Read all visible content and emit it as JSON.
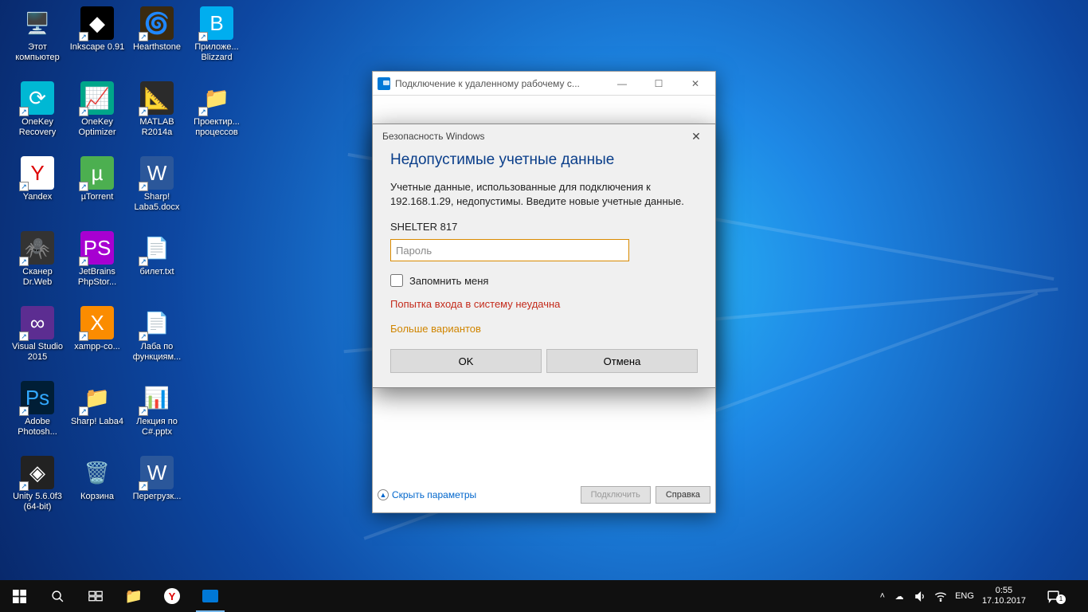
{
  "desktop_icons": [
    {
      "label": "Этот компьютер",
      "col": 0,
      "row": 0,
      "glyph": "🖥️",
      "bg": ""
    },
    {
      "label": "Inkscape 0.91",
      "col": 1,
      "row": 0,
      "glyph": "◆",
      "bg": "#000"
    },
    {
      "label": "Hearthstone",
      "col": 2,
      "row": 0,
      "glyph": "🌀",
      "bg": "#3a2a10"
    },
    {
      "label": "Приложе... Blizzard",
      "col": 3,
      "row": 0,
      "glyph": "B",
      "bg": "#00aeef"
    },
    {
      "label": "OneKey Recovery",
      "col": 0,
      "row": 1,
      "glyph": "⟳",
      "bg": "#00b8d4"
    },
    {
      "label": "OneKey Optimizer",
      "col": 1,
      "row": 1,
      "glyph": "📈",
      "bg": "#00a68a"
    },
    {
      "label": "MATLAB R2014a",
      "col": 2,
      "row": 1,
      "glyph": "📐",
      "bg": "#2b2b2b"
    },
    {
      "label": "Проектир... процессов",
      "col": 3,
      "row": 1,
      "glyph": "📁",
      "bg": ""
    },
    {
      "label": "Yandex",
      "col": 0,
      "row": 2,
      "glyph": "Y",
      "bg": "#fff",
      "fg": "#d00"
    },
    {
      "label": "µTorrent",
      "col": 1,
      "row": 2,
      "glyph": "µ",
      "bg": "#4caf50"
    },
    {
      "label": "Sharp! Laba5.docx",
      "col": 2,
      "row": 2,
      "glyph": "W",
      "bg": "#2b579a"
    },
    {
      "label": "Сканер Dr.Web",
      "col": 0,
      "row": 3,
      "glyph": "🕷️",
      "bg": "#333"
    },
    {
      "label": "JetBrains PhpStor...",
      "col": 1,
      "row": 3,
      "glyph": "PS",
      "bg": "#a700d1"
    },
    {
      "label": "билет.txt",
      "col": 2,
      "row": 3,
      "glyph": "📄",
      "bg": ""
    },
    {
      "label": "Visual Studio 2015",
      "col": 0,
      "row": 4,
      "glyph": "∞",
      "bg": "#5c2d91"
    },
    {
      "label": "xampp-co...",
      "col": 1,
      "row": 4,
      "glyph": "X",
      "bg": "#fb8c00"
    },
    {
      "label": "Лаба по функциям...",
      "col": 2,
      "row": 4,
      "glyph": "📄",
      "bg": ""
    },
    {
      "label": "Adobe Photosh...",
      "col": 0,
      "row": 5,
      "glyph": "Ps",
      "bg": "#001e36",
      "fg": "#31a8ff"
    },
    {
      "label": "Sharp! Laba4",
      "col": 1,
      "row": 5,
      "glyph": "📁",
      "bg": ""
    },
    {
      "label": "Лекция по C#.pptx",
      "col": 2,
      "row": 5,
      "glyph": "📊",
      "bg": ""
    },
    {
      "label": "Unity 5.6.0f3 (64-bit)",
      "col": 0,
      "row": 6,
      "glyph": "◈",
      "bg": "#222"
    },
    {
      "label": "Корзина",
      "col": 1,
      "row": 6,
      "glyph": "🗑️",
      "bg": ""
    },
    {
      "label": "Перегрузк...",
      "col": 2,
      "row": 6,
      "glyph": "W",
      "bg": "#2b579a"
    }
  ],
  "rdp_window": {
    "title": "Подключение к удаленному рабочему с...",
    "hide_params": "Скрыть параметры",
    "connect": "Подключить",
    "help": "Справка"
  },
  "cred_dialog": {
    "titlebar": "Безопасность Windows",
    "heading": "Недопустимые учетные данные",
    "description": "Учетные данные, использованные для подключения к 192.168.1.29, недопустимы. Введите новые учетные данные.",
    "username": "SHELTER 817",
    "password_placeholder": "Пароль",
    "remember": "Запомнить меня",
    "error": "Попытка входа в систему неудачна",
    "more_options": "Больше вариантов",
    "ok": "OK",
    "cancel": "Отмена"
  },
  "taskbar": {
    "lang": "ENG",
    "time": "0:55",
    "date": "17.10.2017",
    "notif_count": "1"
  }
}
